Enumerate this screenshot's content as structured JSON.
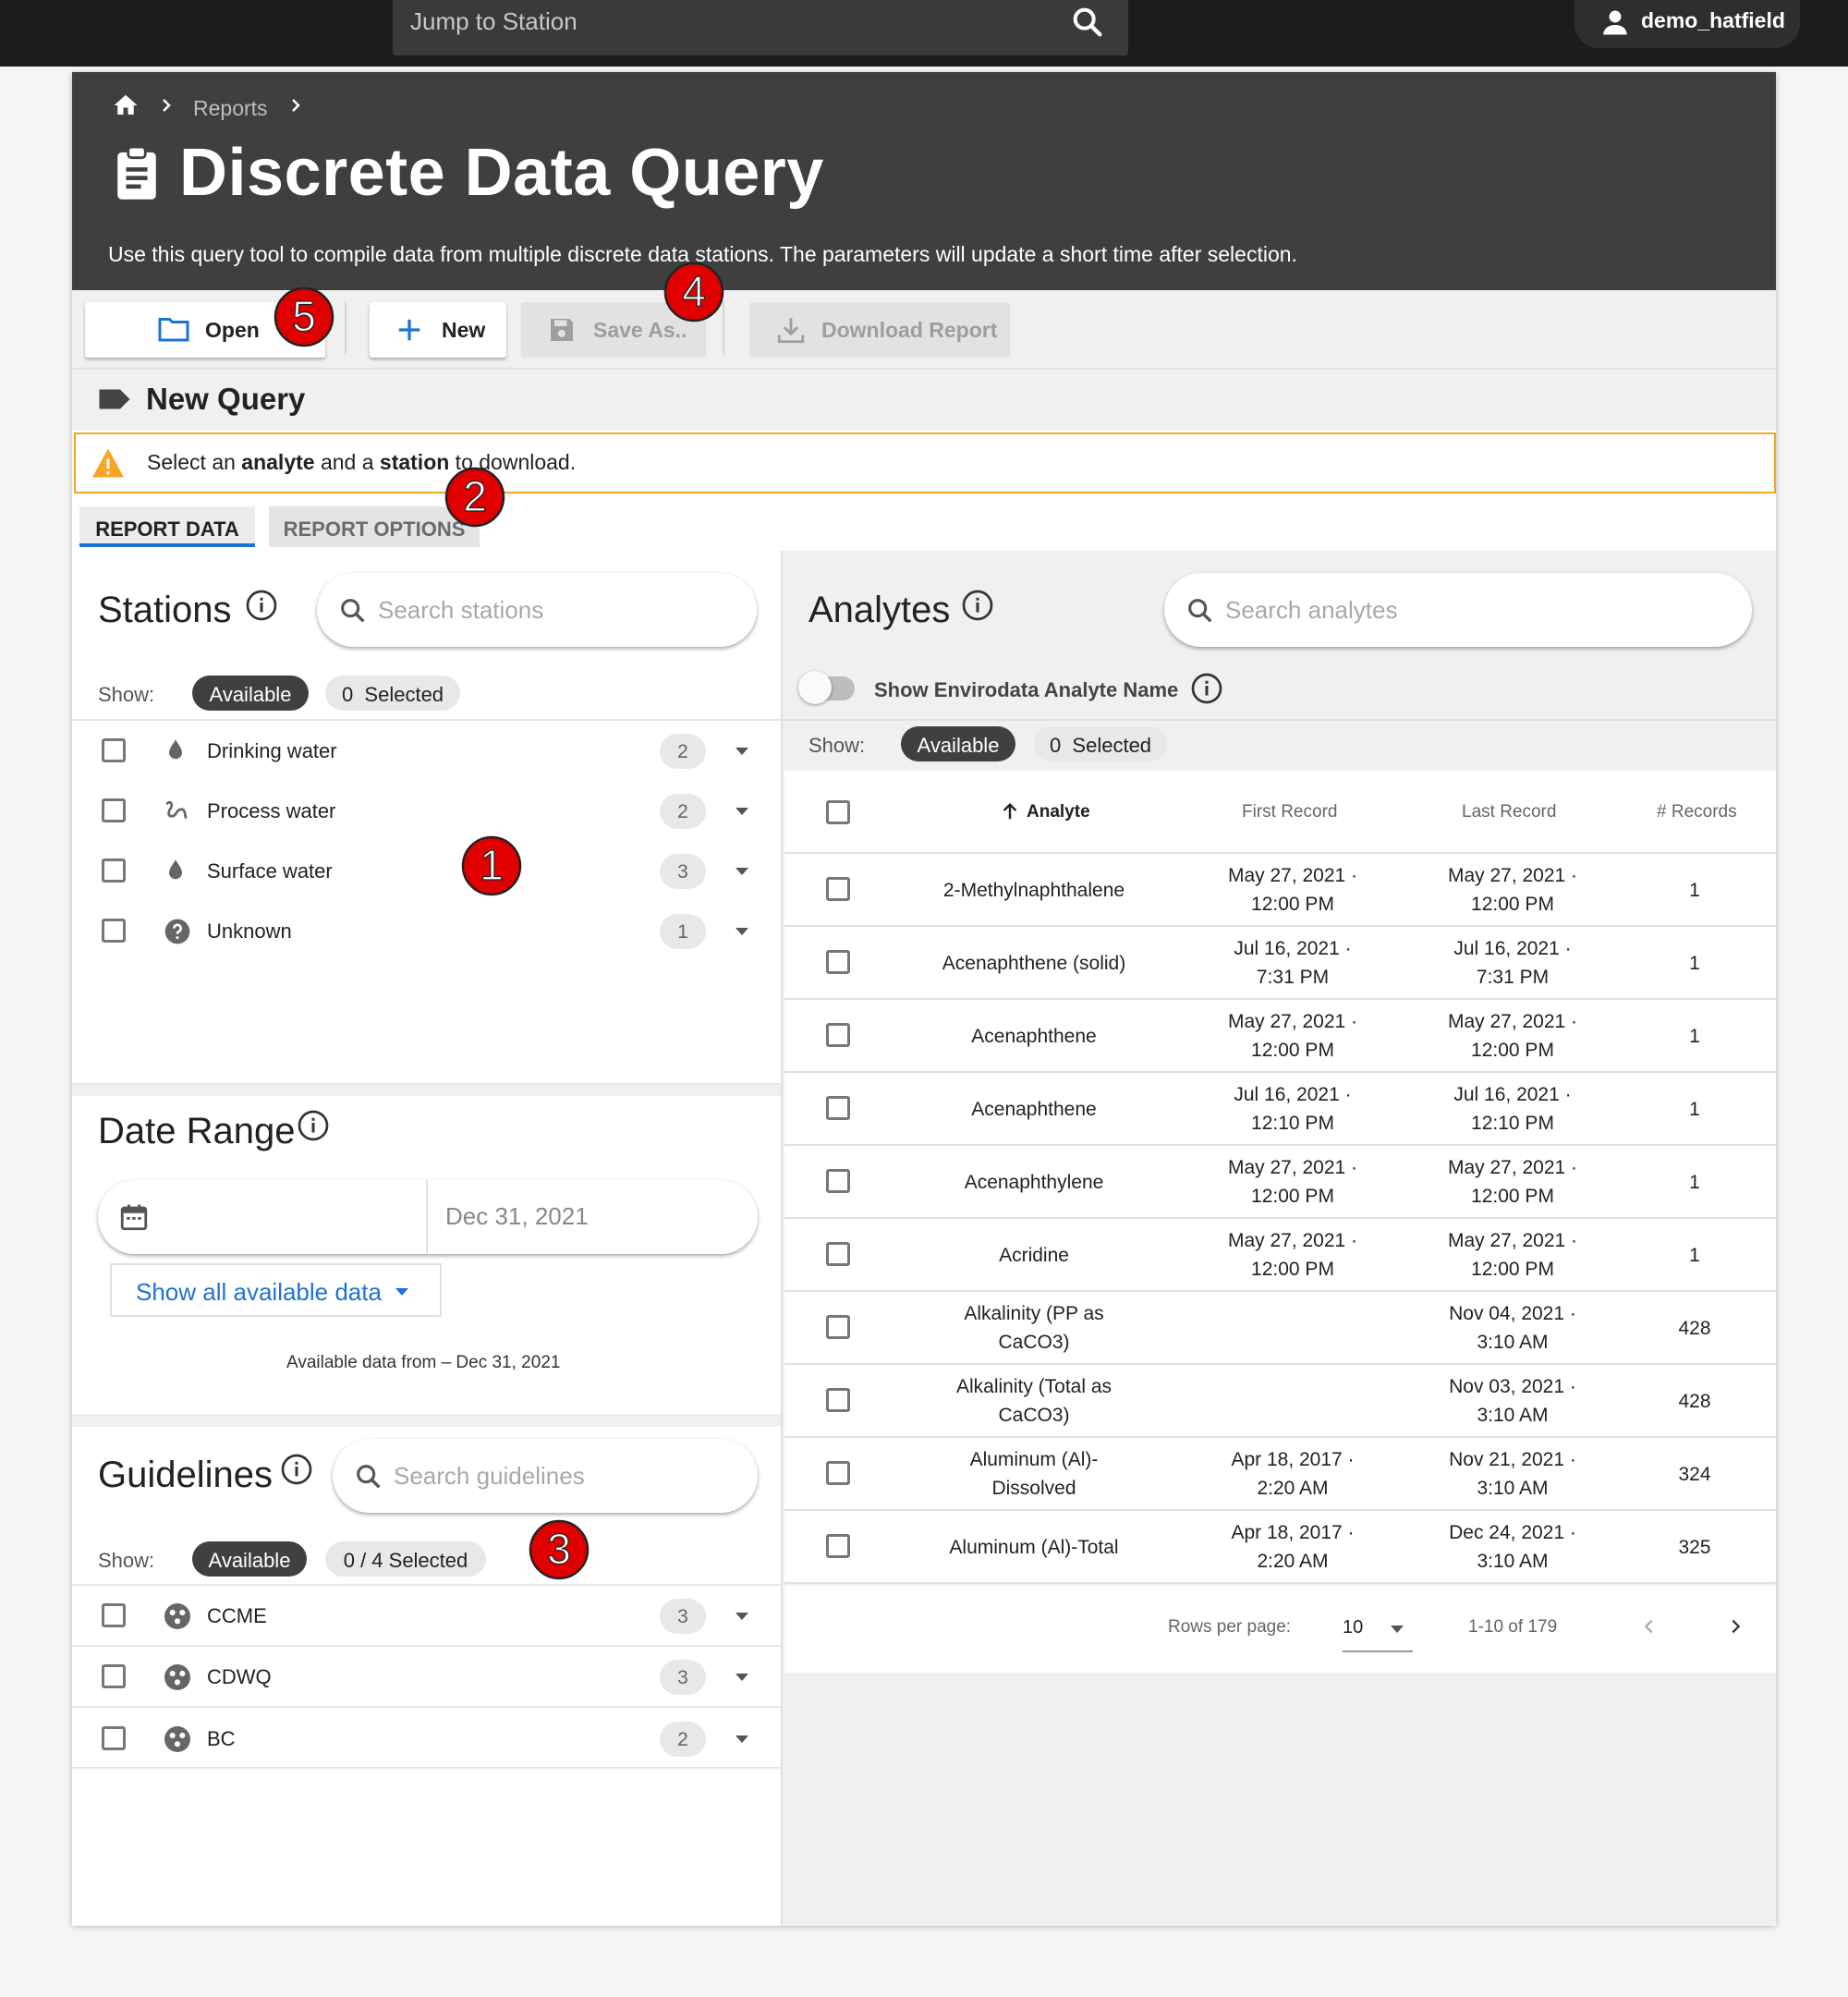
{
  "topbar": {
    "search_placeholder": "Jump to Station",
    "user_name": "demo_hatfield"
  },
  "breadcrumb": {
    "items": [
      "Reports"
    ]
  },
  "header": {
    "title": "Discrete Data Query",
    "description": "Use this query tool to compile data from multiple discrete data stations. The parameters will update a short time after selection."
  },
  "toolbar": {
    "open_label": "Open",
    "new_label": "New",
    "save_as_label": "Save As..",
    "download_label": "Download Report"
  },
  "query": {
    "name": "New Query"
  },
  "alert": {
    "prefix": "Select an ",
    "analyte": "analyte",
    "middle": " and a ",
    "station": "station",
    "suffix": " to download."
  },
  "tabs": [
    {
      "label": "REPORT DATA",
      "active": true
    },
    {
      "label": "REPORT OPTIONS",
      "active": false
    }
  ],
  "stations": {
    "title": "Stations",
    "search_placeholder": "Search stations",
    "show_label": "Show:",
    "available_label": "Available",
    "selected_count": "0",
    "selected_label": "Selected",
    "items": [
      {
        "label": "Drinking water",
        "count": "2",
        "icon": "water-drop-icon"
      },
      {
        "label": "Process water",
        "count": "2",
        "icon": "process-water-icon"
      },
      {
        "label": "Surface water",
        "count": "3",
        "icon": "water-drop-icon"
      },
      {
        "label": "Unknown",
        "count": "1",
        "icon": "help-circle-icon"
      }
    ]
  },
  "date_range": {
    "title": "Date Range",
    "end_date": "Dec 31, 2021",
    "show_all_label": "Show all available data",
    "available_text": "Available data from – Dec 31, 2021"
  },
  "guidelines": {
    "title": "Guidelines",
    "search_placeholder": "Search guidelines",
    "show_label": "Show:",
    "available_label": "Available",
    "selected_label": "0 / 4  Selected",
    "items": [
      {
        "label": "CCME",
        "count": "3"
      },
      {
        "label": "CDWQ",
        "count": "3"
      },
      {
        "label": "BC",
        "count": "2"
      }
    ]
  },
  "analytes": {
    "title": "Analytes",
    "search_placeholder": "Search analytes",
    "toggle_label": "Show Envirodata Analyte Name",
    "show_label": "Show:",
    "available_label": "Available",
    "selected_count": "0",
    "selected_label": "Selected",
    "columns": [
      "Analyte",
      "First Record",
      "Last Record",
      "# Records"
    ],
    "rows": [
      {
        "analyte": [
          "2-Methylnaphthalene"
        ],
        "first": [
          "May 27, 2021 ·",
          "12:00 PM"
        ],
        "last": [
          "May 27, 2021 ·",
          "12:00 PM"
        ],
        "records": "1"
      },
      {
        "analyte": [
          "Acenaphthene (solid)"
        ],
        "first": [
          "Jul 16, 2021 ·",
          "7:31 PM"
        ],
        "last": [
          "Jul 16, 2021 ·",
          "7:31 PM"
        ],
        "records": "1"
      },
      {
        "analyte": [
          "Acenaphthene"
        ],
        "first": [
          "May 27, 2021 ·",
          "12:00 PM"
        ],
        "last": [
          "May 27, 2021 ·",
          "12:00 PM"
        ],
        "records": "1"
      },
      {
        "analyte": [
          "Acenaphthene"
        ],
        "first": [
          "Jul 16, 2021 ·",
          "12:10 PM"
        ],
        "last": [
          "Jul 16, 2021 ·",
          "12:10 PM"
        ],
        "records": "1"
      },
      {
        "analyte": [
          "Acenaphthylene"
        ],
        "first": [
          "May 27, 2021 ·",
          "12:00 PM"
        ],
        "last": [
          "May 27, 2021 ·",
          "12:00 PM"
        ],
        "records": "1"
      },
      {
        "analyte": [
          "Acridine"
        ],
        "first": [
          "May 27, 2021 ·",
          "12:00 PM"
        ],
        "last": [
          "May 27, 2021 ·",
          "12:00 PM"
        ],
        "records": "1"
      },
      {
        "analyte": [
          "Alkalinity (PP as",
          "CaCO3)"
        ],
        "first": [
          "",
          ""
        ],
        "last": [
          "Nov 04, 2021 ·",
          "3:10 AM"
        ],
        "records": "428"
      },
      {
        "analyte": [
          "Alkalinity (Total as",
          "CaCO3)"
        ],
        "first": [
          "",
          ""
        ],
        "last": [
          "Nov 03, 2021 ·",
          "3:10 AM"
        ],
        "records": "428"
      },
      {
        "analyte": [
          "Aluminum (Al)-",
          "Dissolved"
        ],
        "first": [
          "Apr 18, 2017 ·",
          "2:20 AM"
        ],
        "last": [
          "Nov 21, 2021 ·",
          "3:10 AM"
        ],
        "records": "324"
      },
      {
        "analyte": [
          "Aluminum (Al)-Total"
        ],
        "first": [
          "Apr 18, 2017 ·",
          "2:20 AM"
        ],
        "last": [
          "Dec 24, 2021 ·",
          "3:10 AM"
        ],
        "records": "325"
      }
    ],
    "pagination": {
      "rows_per_page_label": "Rows per page:",
      "rows_per_page": "10",
      "range": "1-10 of 179"
    }
  },
  "annotations": [
    "1",
    "2",
    "3",
    "4",
    "5"
  ],
  "colors": {
    "accent": "#1e73d2",
    "warning": "#f5a623",
    "header": "#3f3f3f",
    "badge": "#e00000"
  }
}
